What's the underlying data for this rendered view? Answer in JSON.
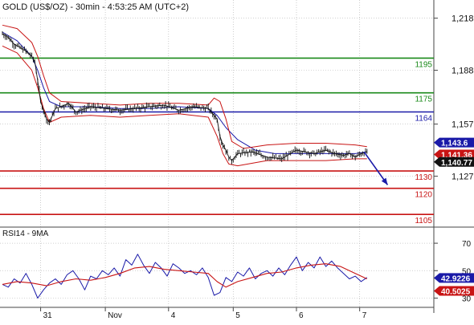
{
  "chart_data": {
    "type": "line",
    "title": "GOLD (US$/OZ) - 30min - 4:53:25 AM (UTC+2)",
    "x_tick_labels": [
      "31",
      "Nov",
      "4",
      "5",
      "6",
      "7"
    ],
    "price_panel": {
      "ylim": [
        1100,
        1222
      ],
      "y_ticks": [
        {
          "value": 1218,
          "label": "1,218"
        },
        {
          "value": 1188,
          "label": "1,188"
        },
        {
          "value": 1157,
          "label": "1,157"
        },
        {
          "value": 1127,
          "label": "1,127"
        }
      ],
      "levels": [
        {
          "value": 1195,
          "label": "1195",
          "color": "#1a8a1a"
        },
        {
          "value": 1175,
          "label": "1175",
          "color": "#1a8a1a"
        },
        {
          "value": 1164,
          "label": "1164",
          "color": "#1a1aa8"
        },
        {
          "value": 1130,
          "label": "1130",
          "color": "#c81414"
        },
        {
          "value": 1120,
          "label": "1120",
          "color": "#c81414"
        },
        {
          "value": 1105,
          "label": "1105",
          "color": "#c81414"
        }
      ],
      "badges": [
        {
          "value": 1143.6,
          "label": "1,143.6",
          "color": "#1a1aa8"
        },
        {
          "value": 1141.36,
          "label": "1,141.36",
          "color": "#c81414"
        },
        {
          "value": 1140.77,
          "label": "1,140.77",
          "color": "#111111"
        }
      ],
      "series": [
        {
          "role": "price",
          "color": "#111111",
          "x": [
            0,
            4,
            8,
            12,
            16,
            20,
            22,
            24,
            26,
            28,
            30,
            32,
            36,
            40,
            45,
            50,
            60,
            70,
            80,
            90,
            100,
            110,
            120,
            130,
            140,
            146,
            148,
            150,
            152,
            154,
            156,
            160,
            170,
            180,
            190,
            200,
            212,
            220,
            226,
            232,
            236,
            240,
            244,
            248
          ],
          "y": [
            1209,
            1207,
            1203,
            1201,
            1199,
            1196,
            1193,
            1182,
            1170,
            1165,
            1160,
            1158,
            1166,
            1167,
            1169,
            1164,
            1167,
            1166,
            1165,
            1166,
            1167,
            1168,
            1165,
            1167,
            1166,
            1160,
            1150,
            1145,
            1142,
            1138,
            1136,
            1140,
            1141,
            1138,
            1137,
            1142,
            1140,
            1142,
            1140,
            1139,
            1140,
            1138,
            1140,
            1141
          ]
        },
        {
          "role": "moving-average",
          "color": "#1a1aa8",
          "x": [
            0,
            10,
            20,
            24,
            28,
            32,
            40,
            60,
            80,
            100,
            120,
            140,
            146,
            152,
            160,
            172,
            185,
            200,
            220,
            240,
            248
          ],
          "y": [
            1210,
            1205,
            1196,
            1188,
            1178,
            1170,
            1167,
            1167,
            1166,
            1166,
            1167,
            1166,
            1162,
            1155,
            1148,
            1142,
            1140,
            1140,
            1140,
            1140,
            1141
          ]
        },
        {
          "role": "upper-band",
          "color": "#c81414",
          "x": [
            0,
            10,
            20,
            24,
            28,
            32,
            40,
            60,
            80,
            100,
            120,
            140,
            144,
            148,
            152,
            156,
            164,
            180,
            200,
            220,
            240,
            248
          ],
          "y": [
            1214,
            1212,
            1204,
            1196,
            1185,
            1175,
            1170,
            1169,
            1168,
            1169,
            1169,
            1168,
            1172,
            1170,
            1160,
            1147,
            1143,
            1145,
            1146,
            1146,
            1145,
            1144
          ]
        },
        {
          "role": "lower-band",
          "color": "#c81414",
          "x": [
            0,
            10,
            20,
            24,
            28,
            32,
            40,
            60,
            80,
            100,
            120,
            140,
            146,
            150,
            154,
            160,
            180,
            200,
            220,
            240,
            248
          ],
          "y": [
            1202,
            1198,
            1188,
            1178,
            1166,
            1158,
            1161,
            1162,
            1161,
            1162,
            1163,
            1161,
            1150,
            1140,
            1134,
            1133,
            1136,
            1136,
            1136,
            1137,
            1137
          ]
        }
      ],
      "forecast": {
        "from": [
          246,
          1141
        ],
        "to": [
          262,
          1122
        ],
        "color": "#1a1aa8"
      }
    },
    "rsi_panel": {
      "title": "RSI14 - 9MA",
      "ylim": [
        25,
        80
      ],
      "y_ticks": [
        {
          "value": 70,
          "label": "70"
        },
        {
          "value": 50,
          "label": "50"
        },
        {
          "value": 30,
          "label": "30"
        }
      ],
      "badges": [
        {
          "value": 42.92,
          "label": "42.9226",
          "color": "#1a1aa8"
        },
        {
          "value": 40.5,
          "label": "40.5025",
          "color": "#c81414"
        }
      ],
      "series": [
        {
          "role": "rsi",
          "color": "#1a1aa8",
          "x": [
            0,
            4,
            8,
            12,
            16,
            20,
            24,
            28,
            32,
            36,
            40,
            44,
            48,
            52,
            56,
            60,
            64,
            68,
            72,
            76,
            80,
            84,
            88,
            92,
            96,
            100,
            104,
            108,
            112,
            116,
            120,
            124,
            128,
            132,
            136,
            140,
            144,
            148,
            152,
            156,
            160,
            164,
            168,
            172,
            176,
            180,
            184,
            188,
            192,
            196,
            200,
            204,
            208,
            212,
            216,
            220,
            224,
            228,
            232,
            236,
            240,
            244,
            248
          ],
          "y": [
            40,
            38,
            44,
            41,
            48,
            40,
            30,
            36,
            41,
            44,
            40,
            47,
            50,
            44,
            36,
            46,
            44,
            50,
            47,
            52,
            46,
            58,
            54,
            62,
            54,
            48,
            56,
            52,
            46,
            55,
            52,
            48,
            50,
            47,
            52,
            45,
            32,
            34,
            45,
            42,
            49,
            46,
            52,
            44,
            48,
            50,
            46,
            52,
            47,
            54,
            60,
            50,
            56,
            52,
            60,
            53,
            57,
            52,
            48,
            44,
            46,
            42,
            45
          ]
        },
        {
          "role": "rsi-ma",
          "color": "#c81414",
          "x": [
            0,
            10,
            20,
            30,
            40,
            50,
            60,
            70,
            80,
            90,
            100,
            110,
            120,
            130,
            140,
            146,
            152,
            160,
            170,
            180,
            190,
            200,
            210,
            220,
            230,
            240,
            248
          ],
          "y": [
            40,
            42,
            41,
            39,
            42,
            44,
            43,
            45,
            48,
            52,
            53,
            51,
            50,
            49,
            48,
            42,
            38,
            42,
            45,
            48,
            49,
            52,
            54,
            55,
            53,
            48,
            44
          ]
        }
      ]
    }
  }
}
